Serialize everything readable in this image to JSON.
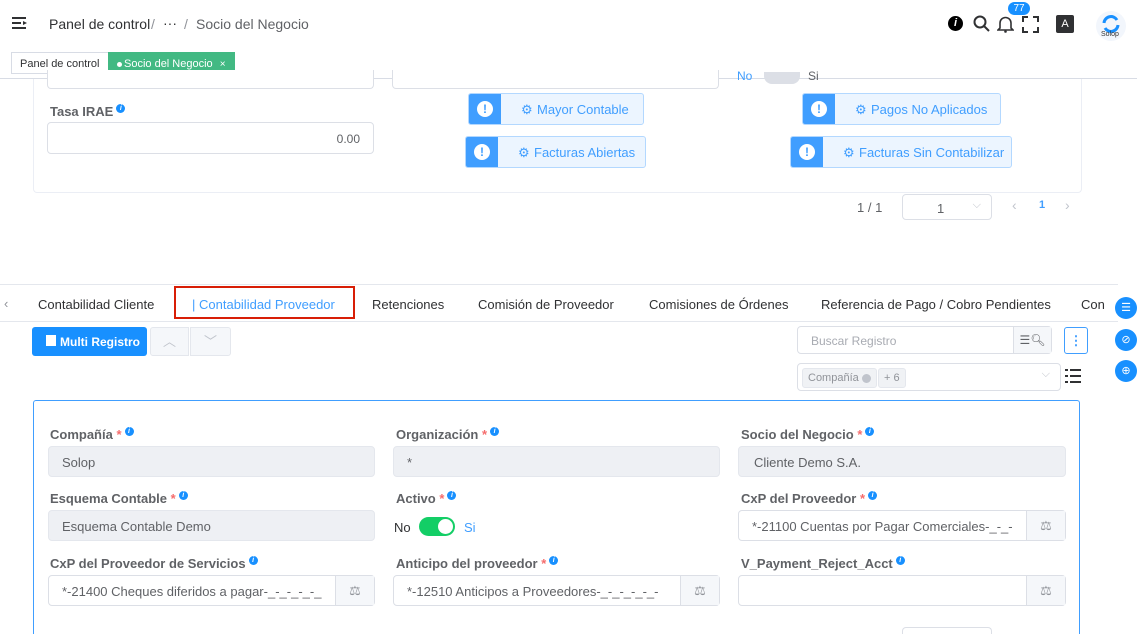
{
  "header": {
    "breadcrumb_root": "Panel de control",
    "breadcrumb_sep": "/",
    "breadcrumb_ellipsis": "···",
    "breadcrumb_current": "Socio del Negocio",
    "notification_count": "77",
    "logo_text": "Solop"
  },
  "tags": {
    "home": "Panel de control",
    "active": "Socio del Negocio",
    "close": "×"
  },
  "upper_form": {
    "tasa_label": "Tasa IRAE",
    "tasa_value": "0.00",
    "toggle_no": "No",
    "toggle_si": "Si",
    "buttons": [
      "Mayor Contable",
      "Pagos No Aplicados",
      "Facturas Abiertas",
      "Facturas Sin Contabilizar"
    ],
    "pagination_count": "1 / 1",
    "page_select": "1",
    "current_page": "1"
  },
  "tabs": [
    "Contabilidad Cliente",
    "Contabilidad Proveedor",
    "Retenciones",
    "Comisión de Proveedor",
    "Comisiones de Órdenes",
    "Referencia de Pago / Cobro Pendientes",
    "Con"
  ],
  "toolbar": {
    "multi_registro": "Multi Registro",
    "search_placeholder": "Buscar Registro",
    "filter_tag": "Compañía",
    "filter_more": "+ 6"
  },
  "record": {
    "fields": [
      {
        "label": "Compañía",
        "value": "Solop"
      },
      {
        "label": "Organización",
        "value": "*"
      },
      {
        "label": "Socio del Negocio",
        "value": "Cliente Demo S.A."
      },
      {
        "label": "Esquema Contable",
        "value": "Esquema Contable Demo"
      },
      {
        "label": "Activo",
        "value": ""
      },
      {
        "label": "CxP del Proveedor",
        "value": "*-21100 Cuentas por Pagar Comerciales-_-_-"
      },
      {
        "label": "CxP del Proveedor de Servicios",
        "value": "*-21400 Cheques diferidos a pagar-_-_-_-_-_"
      },
      {
        "label": "Anticipo del proveedor",
        "value": "*-12510 Anticipos a Proveedores-_-_-_-_-_-"
      },
      {
        "label": "V_Payment_Reject_Acct",
        "value": ""
      }
    ],
    "toggle_no": "No",
    "toggle_si": "Si"
  },
  "colors": {
    "primary": "#409eff",
    "tag_active": "#42b983",
    "highlight": "#d81e06"
  }
}
